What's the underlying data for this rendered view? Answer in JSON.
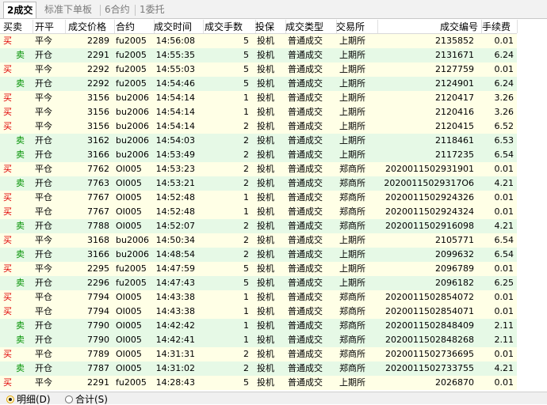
{
  "tabs": [
    {
      "label": "2成交",
      "active": true
    },
    {
      "label": "标准下单板",
      "active": false
    },
    {
      "label": "6合约",
      "active": false
    },
    {
      "label": "1委托",
      "active": false
    }
  ],
  "columns": [
    "买卖",
    "开平",
    "成交价格",
    "合约",
    "成交时间",
    "成交手数",
    "投保",
    "成交类型",
    "交易所",
    "成交编号",
    "手续费"
  ],
  "rows": [
    [
      "买",
      "平今",
      "2289",
      "fu2005",
      "14:56:08",
      "5",
      "投机",
      "普通成交",
      "上期所",
      "2135852",
      "0.01"
    ],
    [
      "卖",
      "开仓",
      "2291",
      "fu2005",
      "14:55:35",
      "5",
      "投机",
      "普通成交",
      "上期所",
      "2131671",
      "6.24"
    ],
    [
      "买",
      "平今",
      "2292",
      "fu2005",
      "14:55:03",
      "5",
      "投机",
      "普通成交",
      "上期所",
      "2127759",
      "0.01"
    ],
    [
      "卖",
      "开仓",
      "2292",
      "fu2005",
      "14:54:46",
      "5",
      "投机",
      "普通成交",
      "上期所",
      "2124901",
      "6.24"
    ],
    [
      "买",
      "平今",
      "3156",
      "bu2006",
      "14:54:14",
      "1",
      "投机",
      "普通成交",
      "上期所",
      "2120417",
      "3.26"
    ],
    [
      "买",
      "平今",
      "3156",
      "bu2006",
      "14:54:14",
      "1",
      "投机",
      "普通成交",
      "上期所",
      "2120416",
      "3.26"
    ],
    [
      "买",
      "平今",
      "3156",
      "bu2006",
      "14:54:14",
      "2",
      "投机",
      "普通成交",
      "上期所",
      "2120415",
      "6.52"
    ],
    [
      "卖",
      "开仓",
      "3162",
      "bu2006",
      "14:54:03",
      "2",
      "投机",
      "普通成交",
      "上期所",
      "2118461",
      "6.53"
    ],
    [
      "卖",
      "开仓",
      "3166",
      "bu2006",
      "14:53:49",
      "2",
      "投机",
      "普通成交",
      "上期所",
      "2117235",
      "6.54"
    ],
    [
      "买",
      "平仓",
      "7762",
      "OI005",
      "14:53:23",
      "2",
      "投机",
      "普通成交",
      "郑商所",
      "202001150293190 1",
      "0.01"
    ],
    [
      "卖",
      "开仓",
      "7763",
      "OI005",
      "14:53:21",
      "2",
      "投机",
      "普通成交",
      "郑商所",
      "20200115029317O6",
      "4.21"
    ],
    [
      "买",
      "平仓",
      "7767",
      "OI005",
      "14:52:48",
      "1",
      "投机",
      "普通成交",
      "郑商所",
      "202001150292432 6",
      "0.01"
    ],
    [
      "买",
      "平仓",
      "7767",
      "OI005",
      "14:52:48",
      "1",
      "投机",
      "普通成交",
      "郑商所",
      "202001150292432 4",
      "0.01"
    ],
    [
      "卖",
      "开仓",
      "7788",
      "OI005",
      "14:52:07",
      "2",
      "投机",
      "普通成交",
      "郑商所",
      "202001150291609 8",
      "4.21"
    ],
    [
      "买",
      "平今",
      "3168",
      "bu2006",
      "14:50:34",
      "2",
      "投机",
      "普通成交",
      "上期所",
      "2105771",
      "6.54"
    ],
    [
      "卖",
      "开仓",
      "3166",
      "bu2006",
      "14:48:54",
      "2",
      "投机",
      "普通成交",
      "上期所",
      "2099632",
      "6.54"
    ],
    [
      "买",
      "平今",
      "2295",
      "fu2005",
      "14:47:59",
      "5",
      "投机",
      "普通成交",
      "上期所",
      "2096789",
      "0.01"
    ],
    [
      "卖",
      "开仓",
      "2296",
      "fu2005",
      "14:47:43",
      "5",
      "投机",
      "普通成交",
      "上期所",
      "2096182",
      "6.25"
    ],
    [
      "买",
      "平仓",
      "7794",
      "OI005",
      "14:43:38",
      "1",
      "投机",
      "普通成交",
      "郑商所",
      "202001150285407 2",
      "0.01"
    ],
    [
      "买",
      "平仓",
      "7794",
      "OI005",
      "14:43:38",
      "1",
      "投机",
      "普通成交",
      "郑商所",
      "202001150285407 1",
      "0.01"
    ],
    [
      "卖",
      "开仓",
      "7790",
      "OI005",
      "14:42:42",
      "1",
      "投机",
      "普通成交",
      "郑商所",
      "202001150284840 9",
      "2.11"
    ],
    [
      "卖",
      "开仓",
      "7790",
      "OI005",
      "14:42:41",
      "1",
      "投机",
      "普通成交",
      "郑商所",
      "202001150284826 8",
      "2.11"
    ],
    [
      "买",
      "平仓",
      "7789",
      "OI005",
      "14:31:31",
      "2",
      "投机",
      "普通成交",
      "郑商所",
      "202001150273669 5",
      "0.01"
    ],
    [
      "卖",
      "开仓",
      "7787",
      "OI005",
      "14:31:02",
      "2",
      "投机",
      "普通成交",
      "郑商所",
      "202001150273375 5",
      "4.21"
    ],
    [
      "买",
      "平今",
      "2291",
      "fu2005",
      "14:28:43",
      "5",
      "投机",
      "普通成交",
      "上期所",
      "2026870",
      "0.01"
    ]
  ],
  "footer": {
    "detail_label": "明细(D)",
    "summary_label": "合计(S)",
    "selected": "detail"
  },
  "colors": {
    "buy": "#e00000",
    "sell": "#009100",
    "row_buy": "#ffffe6",
    "row_sell": "#e6f9e6"
  }
}
